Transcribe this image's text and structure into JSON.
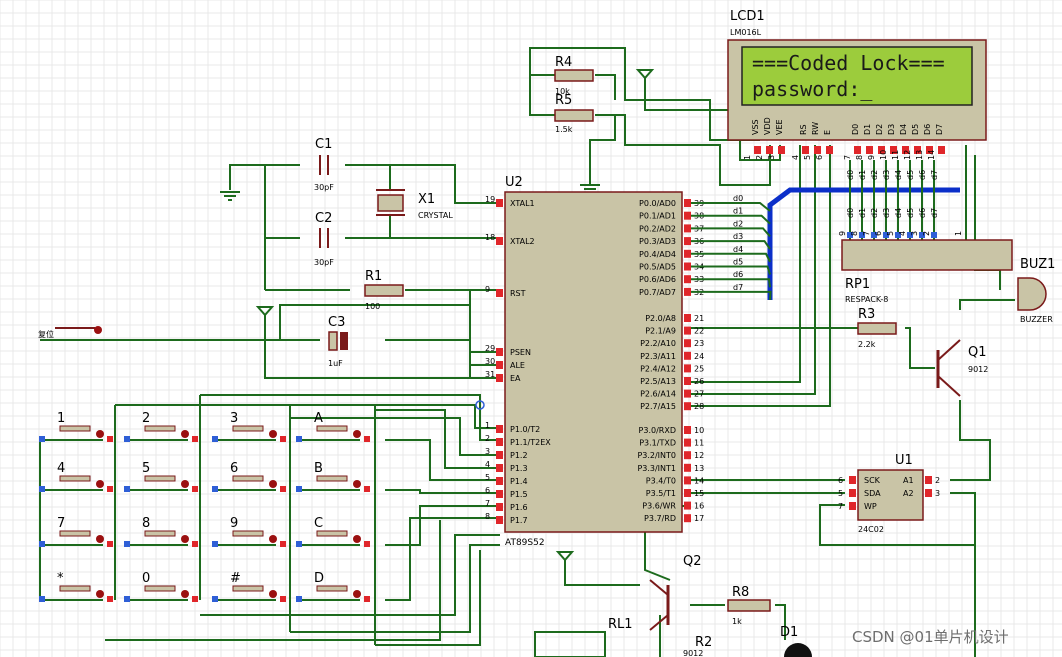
{
  "lcd": {
    "ref": "LCD1",
    "part": "LM016L",
    "line1": "===Coded Lock===",
    "line2": "password:_",
    "pins": [
      "VSS",
      "VDD",
      "VEE",
      "RS",
      "RW",
      "E",
      "D0",
      "D1",
      "D2",
      "D3",
      "D4",
      "D5",
      "D6",
      "D7"
    ],
    "pin_numbers": [
      "1",
      "2",
      "3",
      "4",
      "5",
      "6",
      "7",
      "8",
      "9",
      "10",
      "11",
      "12",
      "13",
      "14"
    ]
  },
  "mcu": {
    "ref": "U2",
    "part": "AT89S52",
    "left_pins": [
      {
        "num": "19",
        "name": "XTAL1"
      },
      {
        "num": "18",
        "name": "XTAL2"
      },
      {
        "num": "9",
        "name": "RST"
      },
      {
        "num": "29",
        "name": "PSEN"
      },
      {
        "num": "30",
        "name": "ALE"
      },
      {
        "num": "31",
        "name": "EA"
      },
      {
        "num": "1",
        "name": "P1.0/T2"
      },
      {
        "num": "2",
        "name": "P1.1/T2EX"
      },
      {
        "num": "3",
        "name": "P1.2"
      },
      {
        "num": "4",
        "name": "P1.3"
      },
      {
        "num": "5",
        "name": "P1.4"
      },
      {
        "num": "6",
        "name": "P1.5"
      },
      {
        "num": "7",
        "name": "P1.6"
      },
      {
        "num": "8",
        "name": "P1.7"
      }
    ],
    "right_pins": [
      {
        "num": "39",
        "name": "P0.0/AD0"
      },
      {
        "num": "38",
        "name": "P0.1/AD1"
      },
      {
        "num": "37",
        "name": "P0.2/AD2"
      },
      {
        "num": "36",
        "name": "P0.3/AD3"
      },
      {
        "num": "35",
        "name": "P0.4/AD4"
      },
      {
        "num": "34",
        "name": "P0.5/AD5"
      },
      {
        "num": "33",
        "name": "P0.6/AD6"
      },
      {
        "num": "32",
        "name": "P0.7/AD7"
      },
      {
        "num": "21",
        "name": "P2.0/A8"
      },
      {
        "num": "22",
        "name": "P2.1/A9"
      },
      {
        "num": "23",
        "name": "P2.2/A10"
      },
      {
        "num": "24",
        "name": "P2.3/A11"
      },
      {
        "num": "25",
        "name": "P2.4/A12"
      },
      {
        "num": "26",
        "name": "P2.5/A13"
      },
      {
        "num": "27",
        "name": "P2.6/A14"
      },
      {
        "num": "28",
        "name": "P2.7/A15"
      },
      {
        "num": "10",
        "name": "P3.0/RXD"
      },
      {
        "num": "11",
        "name": "P3.1/TXD"
      },
      {
        "num": "12",
        "name": "P3.2/INT0"
      },
      {
        "num": "13",
        "name": "P3.3/INT1"
      },
      {
        "num": "14",
        "name": "P3.4/T0"
      },
      {
        "num": "15",
        "name": "P3.5/T1"
      },
      {
        "num": "16",
        "name": "P3.6/WR"
      },
      {
        "num": "17",
        "name": "P3.7/RD"
      }
    ],
    "bus_labels": [
      "d0",
      "d1",
      "d2",
      "d3",
      "d4",
      "d5",
      "d6",
      "d7"
    ]
  },
  "components": {
    "c1": {
      "ref": "C1",
      "value": "30pF"
    },
    "c2": {
      "ref": "C2",
      "value": "30pF"
    },
    "x1": {
      "ref": "X1",
      "value": "CRYSTAL"
    },
    "r1": {
      "ref": "R1",
      "value": "100"
    },
    "c3": {
      "ref": "C3",
      "value": "1uF"
    },
    "r4": {
      "ref": "R4",
      "value": "10k"
    },
    "r5": {
      "ref": "R5",
      "value": "1.5k"
    },
    "r3": {
      "ref": "R3",
      "value": "2.2k"
    },
    "q1": {
      "ref": "Q1",
      "value": "9012"
    },
    "q2": {
      "ref": "Q2"
    },
    "r8": {
      "ref": "R8",
      "value": "1k"
    },
    "rl1": {
      "ref": "RL1"
    },
    "r2": {
      "ref": "R2",
      "value": "9012"
    },
    "d1": {
      "ref": "D1"
    },
    "reset_label": "复位"
  },
  "resistor_pack": {
    "ref": "RP1",
    "part": "RESPACK-8",
    "pin_labels": [
      "d0",
      "d1",
      "d2",
      "d3",
      "d4",
      "d5",
      "d6",
      "d7"
    ],
    "pin_numbers": [
      "9",
      "8",
      "7",
      "6",
      "5",
      "4",
      "3",
      "2",
      "1"
    ]
  },
  "buzzer": {
    "ref": "BUZ1",
    "part": "BUZZER"
  },
  "eeprom": {
    "ref": "U1",
    "part": "24C02",
    "left_pins": [
      {
        "num": "6",
        "name": "SCK"
      },
      {
        "num": "5",
        "name": "SDA"
      },
      {
        "num": "7",
        "name": "WP"
      }
    ],
    "right_pins": [
      {
        "num": "2",
        "name": "A1"
      },
      {
        "num": "3",
        "name": "A2"
      }
    ]
  },
  "keypad": {
    "keys": [
      [
        "1",
        "2",
        "3",
        "A"
      ],
      [
        "4",
        "5",
        "6",
        "B"
      ],
      [
        "7",
        "8",
        "9",
        "C"
      ],
      [
        "*",
        "0",
        "#",
        "D"
      ]
    ]
  },
  "watermark": "CSDN @01单片机设计"
}
